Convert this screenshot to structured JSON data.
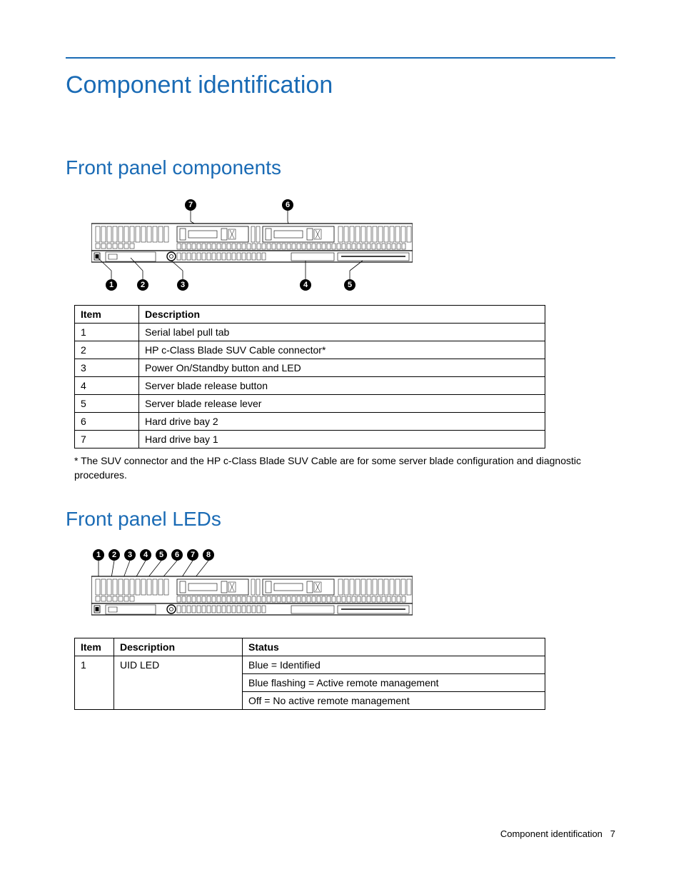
{
  "page_title": "Component identification",
  "sections": {
    "front_panel_components": {
      "heading": "Front panel components",
      "table_headers": {
        "item": "Item",
        "desc": "Description"
      },
      "rows": [
        {
          "item": "1",
          "desc": "Serial label pull tab"
        },
        {
          "item": "2",
          "desc": "HP c-Class Blade SUV Cable connector*"
        },
        {
          "item": "3",
          "desc": "Power On/Standby button and LED"
        },
        {
          "item": "4",
          "desc": "Server blade release button"
        },
        {
          "item": "5",
          "desc": "Server blade release lever"
        },
        {
          "item": "6",
          "desc": "Hard drive bay 2"
        },
        {
          "item": "7",
          "desc": "Hard drive bay 1"
        }
      ],
      "footnote": "* The SUV connector and the HP c-Class Blade SUV Cable are for some server blade configuration and diagnostic procedures."
    },
    "front_panel_leds": {
      "heading": "Front panel LEDs",
      "table_headers": {
        "item": "Item",
        "desc": "Description",
        "status": "Status"
      },
      "rows": [
        {
          "item": "1",
          "desc": "UID LED",
          "status": [
            "Blue = Identified",
            "Blue flashing = Active remote management",
            "Off = No active remote management"
          ]
        }
      ]
    }
  },
  "callouts_diagram1_top": [
    "7",
    "6"
  ],
  "callouts_diagram1_bottom": [
    "1",
    "2",
    "3",
    "4",
    "5"
  ],
  "callouts_diagram2": [
    "1",
    "2",
    "3",
    "4",
    "5",
    "6",
    "7",
    "8"
  ],
  "footer": {
    "section": "Component identification",
    "page": "7"
  }
}
